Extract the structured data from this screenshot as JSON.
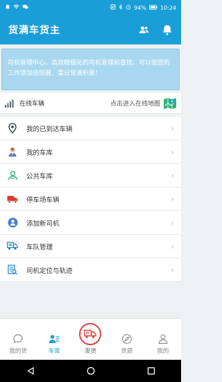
{
  "status_bar": {
    "left_icons": [
      "bell-icon",
      "wifi-icon",
      "message-icon"
    ],
    "right_icons": [
      "nfc-icon",
      "bluetooth-icon",
      "alarm-icon",
      "battery-icon"
    ],
    "battery": "94%",
    "time": "10:24"
  },
  "app": {
    "title": "货满车货主"
  },
  "banner": {
    "text": "司机管理中心，高效精细化的司机管理和查找，可以使您的工作添加倍增器，需日常滴积累！"
  },
  "online": {
    "label": "在线车辆",
    "link_text": "点击进入在线地图"
  },
  "menu": {
    "items": [
      {
        "label": "我的已到达车辆",
        "icon": "location-pin-icon"
      },
      {
        "label": "我的车库",
        "icon": "person-icon"
      },
      {
        "label": "公共车库",
        "icon": "public-garage-icon"
      },
      {
        "label": "停车场车辆",
        "icon": "truck-icon"
      },
      {
        "label": "添加新司机",
        "icon": "add-driver-icon"
      },
      {
        "label": "车队管理",
        "icon": "fleet-icon"
      },
      {
        "label": "司机定位与轨迹",
        "icon": "locate-track-icon"
      }
    ]
  },
  "tabs": [
    {
      "label": "我的货",
      "icon": "chat-icon",
      "active": false
    },
    {
      "label": "车库",
      "icon": "garage-icon",
      "active": true
    },
    {
      "label": "发货",
      "icon": "ship-truck-icon",
      "active": false
    },
    {
      "label": "货源",
      "icon": "compass-icon",
      "active": false
    },
    {
      "label": "我的",
      "icon": "user-icon",
      "active": false
    }
  ],
  "colors": {
    "primary": "#1a9ed8",
    "accent_red": "#e0433b",
    "banner_bg": "#a9d7ef"
  }
}
